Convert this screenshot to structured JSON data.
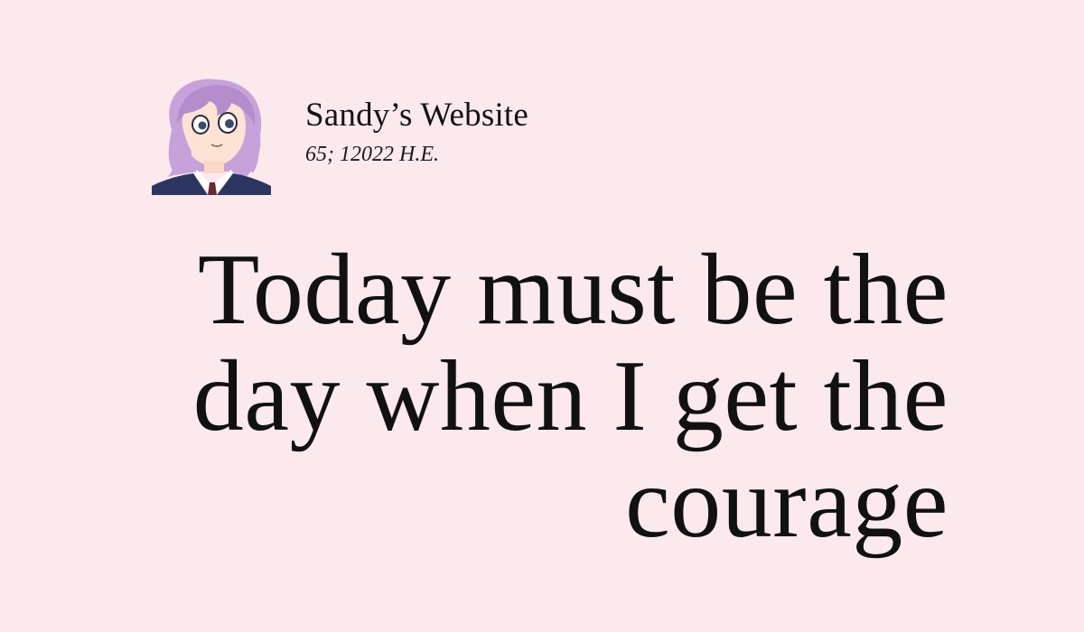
{
  "header": {
    "avatar_icon": "anime-character-avatar",
    "site_name": "Sandy’s Website",
    "date": "65; 12022 H.E."
  },
  "post": {
    "title": "Today must be the day when I get the courage"
  },
  "colors": {
    "background": "#fbe9ee",
    "text": "#141414",
    "hair": "#c8a2d8",
    "jacket": "#2b3560"
  }
}
